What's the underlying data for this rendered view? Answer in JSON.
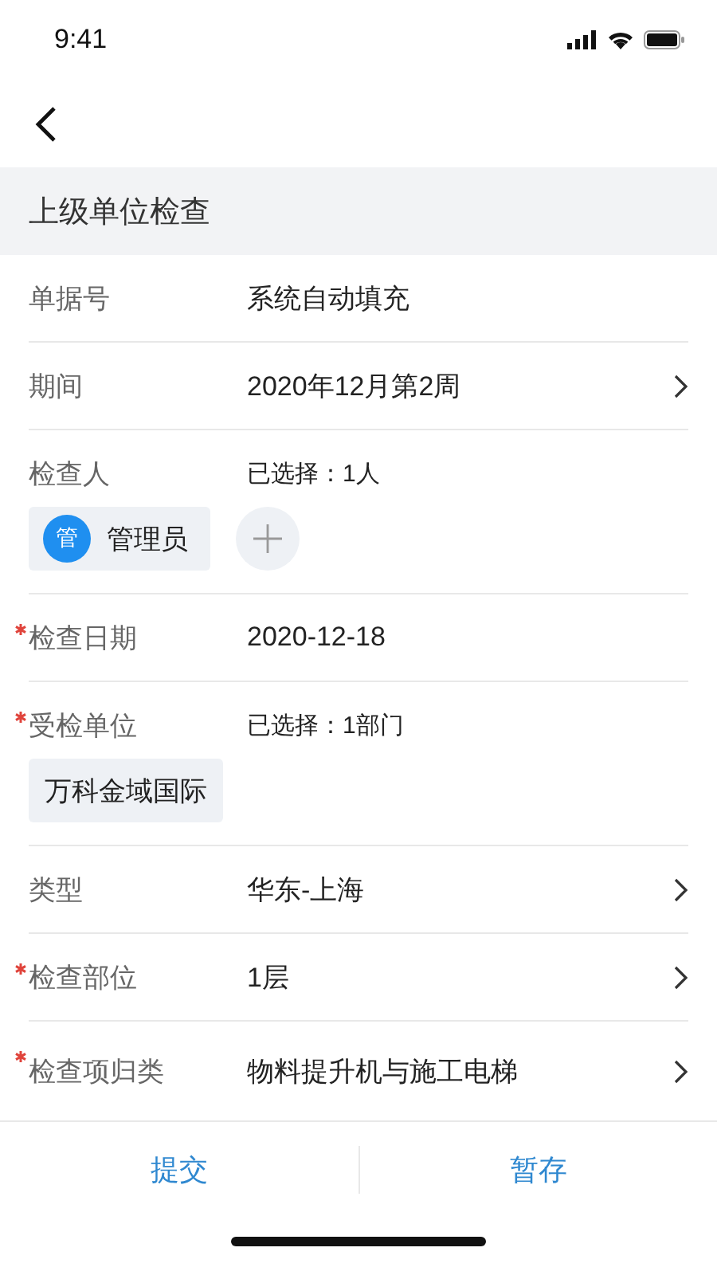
{
  "status_bar": {
    "time": "9:41"
  },
  "section": {
    "title": "上级单位检查"
  },
  "rows": [
    {
      "kind": "text",
      "label": "单据号",
      "required": false,
      "value": "系统自动填充",
      "chevron": false
    },
    {
      "kind": "text",
      "label": "期间",
      "required": false,
      "value": "2020年12月第2周",
      "chevron": true
    },
    {
      "kind": "people",
      "label": "检查人",
      "required": false,
      "value": "已选择：1人",
      "people": [
        {
          "initial": "管",
          "name": "管理员"
        }
      ]
    },
    {
      "kind": "text",
      "label": "检查日期",
      "required": true,
      "value": "2020-12-18",
      "chevron": false
    },
    {
      "kind": "tags",
      "label": "受检单位",
      "required": true,
      "value": "已选择：1部门",
      "tags": [
        "万科金域国际"
      ]
    },
    {
      "kind": "text",
      "label": "类型",
      "required": false,
      "value": "华东-上海",
      "chevron": true
    },
    {
      "kind": "text",
      "label": "检查部位",
      "required": true,
      "value": "1层",
      "chevron": true
    },
    {
      "kind": "text",
      "label": "检查项归类",
      "required": true,
      "value": "物料提升机与施工电梯",
      "chevron": true
    }
  ],
  "actions": [
    "提交",
    "暂存"
  ]
}
